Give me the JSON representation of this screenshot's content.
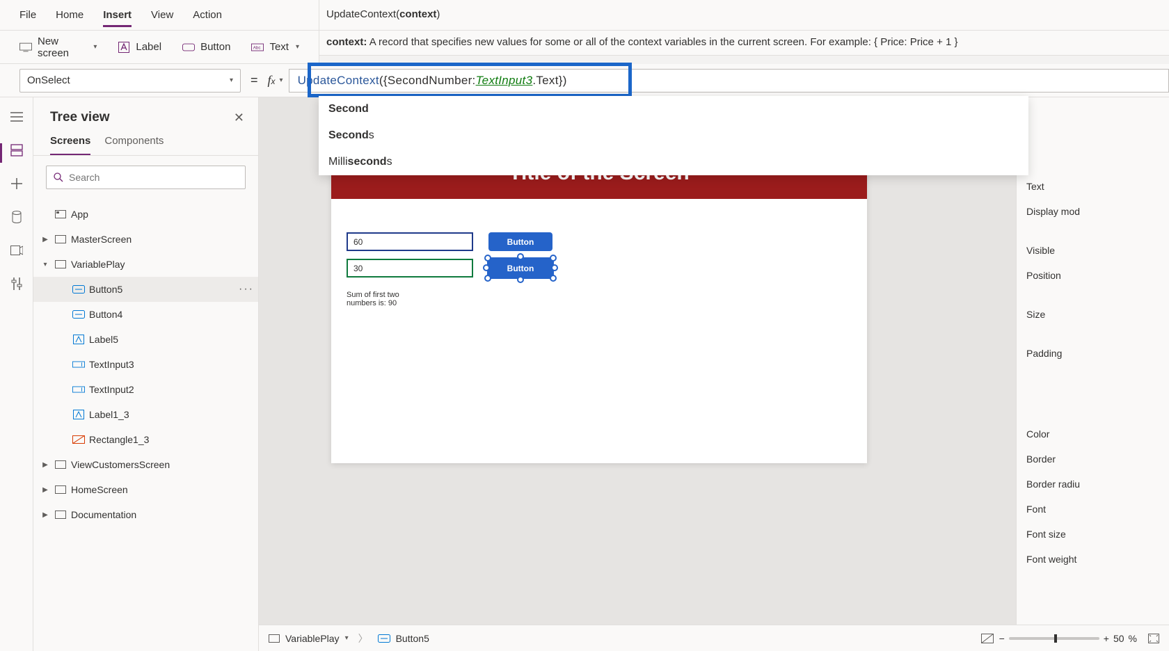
{
  "menu": {
    "file": "File",
    "home": "Home",
    "insert": "Insert",
    "view": "View",
    "action": "Action"
  },
  "ribbon": {
    "new_screen": "New screen",
    "label": "Label",
    "button": "Button",
    "text": "Text"
  },
  "fn_sig": {
    "name": "UpdateContext",
    "arg": "context"
  },
  "context_hint": {
    "lead": "context:",
    "body": "A record that specifies new values for some or all of the context variables in the current screen. For example: { Price: Price + 1 }"
  },
  "prop_selected": "OnSelect",
  "formula": {
    "fn": "UpdateContext",
    "open": "({SecondNumber: ",
    "ref": "TextInput3",
    "tail": ".Text})"
  },
  "ac": {
    "opt1": "Second",
    "opt2_b": "Second",
    "opt2_t": "s",
    "opt3_a": "Milli",
    "opt3_b": "second",
    "opt3_c": "s"
  },
  "tree": {
    "title": "Tree view",
    "tabs": {
      "screens": "Screens",
      "components": "Components"
    },
    "search_ph": "Search",
    "app": "App",
    "n1": "MasterScreen",
    "n2": "VariablePlay",
    "c1": "Button5",
    "c2": "Button4",
    "c3": "Label5",
    "c4": "TextInput3",
    "c5": "TextInput2",
    "c6": "Label1_3",
    "c7": "Rectangle1_3",
    "n3": "ViewCustomersScreen",
    "n4": "HomeScreen",
    "n5": "Documentation"
  },
  "device": {
    "title": "Title of the Screen",
    "in1": "60",
    "in2": "30",
    "btn": "Button",
    "sum": "Sum of first two numbers is: 90"
  },
  "props": {
    "text": "Text",
    "display": "Display mod",
    "visible": "Visible",
    "position": "Position",
    "size": "Size",
    "padding": "Padding",
    "color": "Color",
    "border": "Border",
    "bradius": "Border radiu",
    "font": "Font",
    "fsize": "Font size",
    "fweight": "Font weight"
  },
  "status": {
    "bc1": "VariablePlay",
    "bc2": "Button5",
    "zoom": "50",
    "pct": "%"
  }
}
